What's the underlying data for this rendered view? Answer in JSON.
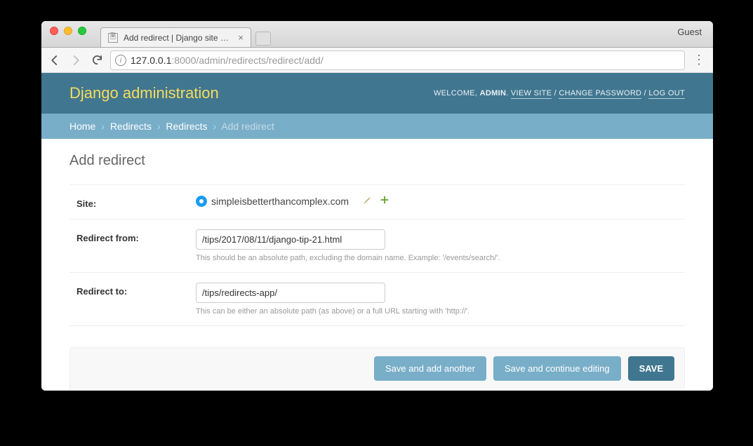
{
  "browser": {
    "tab_title": "Add redirect | Django site admi",
    "guest_label": "Guest",
    "url_host": "127.0.0.1",
    "url_path": ":8000/admin/redirects/redirect/add/"
  },
  "header": {
    "title": "Django administration",
    "welcome": "WELCOME, ",
    "username": "ADMIN",
    "view_site": "VIEW SITE",
    "change_password": "CHANGE PASSWORD",
    "log_out": "LOG OUT",
    "sep": " / ",
    "period": "."
  },
  "breadcrumbs": {
    "home": "Home",
    "level1": "Redirects",
    "level2": "Redirects",
    "current": "Add redirect",
    "sep": "›"
  },
  "page": {
    "title": "Add redirect"
  },
  "fields": {
    "site": {
      "label": "Site:",
      "value": "simpleisbetterthancomplex.com"
    },
    "redirect_from": {
      "label": "Redirect from:",
      "value": "/tips/2017/08/11/django-tip-21.html",
      "help": "This should be an absolute path, excluding the domain name. Example: '/events/search/'."
    },
    "redirect_to": {
      "label": "Redirect to:",
      "value": "/tips/redirects-app/",
      "help": "This can be either an absolute path (as above) or a full URL starting with 'http://'."
    }
  },
  "buttons": {
    "save_add_another": "Save and add another",
    "save_continue": "Save and continue editing",
    "save": "SAVE"
  }
}
